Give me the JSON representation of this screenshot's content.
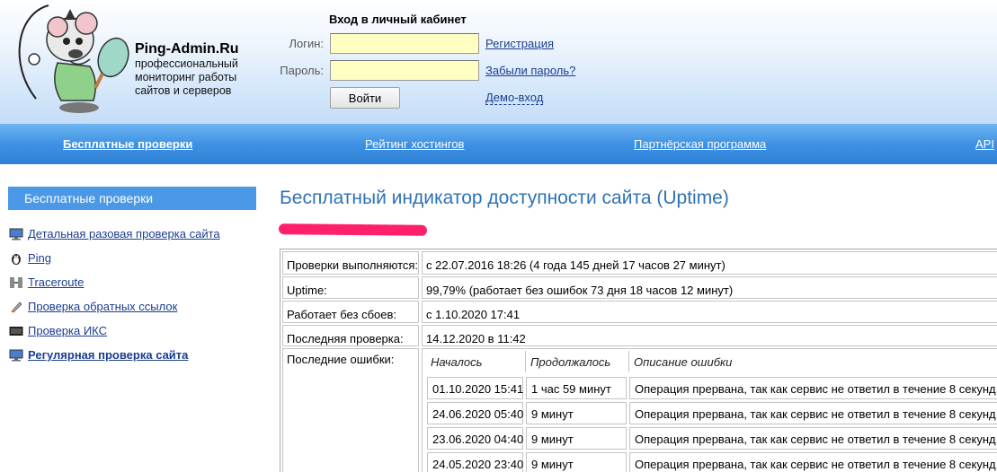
{
  "header": {
    "brand_name": "Ping-Admin.Ru",
    "brand_tagline": "профессиональный мониторинг работы сайтов и серверов",
    "login_title": "Вход в личный кабинет",
    "login_label": "Логин:",
    "password_label": "Пароль:",
    "login_value": "",
    "password_value": "",
    "login_button": "Войти",
    "register_link": "Регистрация",
    "forgot_link": "Забыли пароль?",
    "demo_link": "Демо-вход"
  },
  "nav": {
    "free_checks": "Бесплатные проверки",
    "hosting_rating": "Рейтинг хостингов",
    "partner_program": "Партнёрская программа",
    "api": "API"
  },
  "sidebar": {
    "heading": "Бесплатные проверки",
    "items": [
      {
        "label": "Детальная разовая проверка сайта",
        "icon": "monitor-icon"
      },
      {
        "label": "Ping",
        "icon": "penguin-icon"
      },
      {
        "label": "Traceroute",
        "icon": "network-icon"
      },
      {
        "label": "Проверка обратных ссылок",
        "icon": "rocket-icon"
      },
      {
        "label": "Проверка ИКС",
        "icon": "iks-badge-icon"
      },
      {
        "label": "Регулярная проверка сайта",
        "icon": "monitor-icon"
      }
    ]
  },
  "main": {
    "title": "Бесплатный индикатор доступности сайта (Uptime)",
    "rows": [
      {
        "label": "Проверки выполняются:",
        "value": "с 22.07.2016 18:26 (4 года 145 дней 17 часов 27 минут)"
      },
      {
        "label": "Uptime:",
        "value": "99,79% (работает без ошибок 73 дня 18 часов 12 минут)"
      },
      {
        "label": "Работает без сбоев:",
        "value": "с 1.10.2020 17:41"
      },
      {
        "label": "Последняя проверка:",
        "value": "14.12.2020 в 11:42"
      }
    ],
    "errors_label": "Последние ошибки:",
    "errors_columns": [
      "Началось",
      "Продолжалось",
      "Описание ошибки"
    ],
    "errors": [
      {
        "start": "01.10.2020 15:41",
        "duration": "1 час 59 минут",
        "description": "Операция прервана, так как сервис не ответил в течение 8 секунд."
      },
      {
        "start": "24.06.2020 05:40",
        "duration": "9 минут",
        "description": "Операция прервана, так как сервис не ответил в течение 8 секунд."
      },
      {
        "start": "23.06.2020 04:40",
        "duration": "9 минут",
        "description": "Операция прервана, так как сервис не ответил в течение 8 секунд."
      },
      {
        "start": "24.05.2020 23:40",
        "duration": "9 минут",
        "description": "Операция прервана, так как сервис не ответил в течение 8 секунд."
      }
    ]
  },
  "colors": {
    "nav_blue": "#3e92e4",
    "sidebar_head": "#4a98e6",
    "title_blue": "#2f72b4",
    "link": "#1a3d8f",
    "input_bg": "#ffffc4",
    "redaction": "#ff1f6b"
  }
}
